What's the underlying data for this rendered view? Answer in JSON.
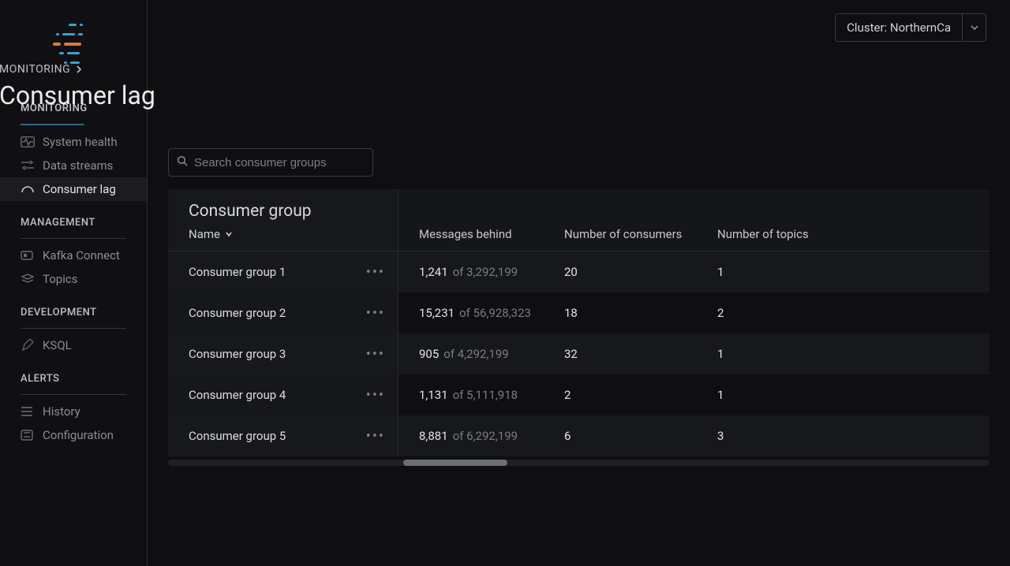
{
  "cluster_selector": {
    "label": "Cluster: NorthernCa"
  },
  "breadcrumb": "MONITORING",
  "page_title": "Consumer lag",
  "search": {
    "placeholder": "Search consumer groups"
  },
  "sidebar": {
    "sections": {
      "monitoring": {
        "title": "MONITORING",
        "items": [
          {
            "label": "System health"
          },
          {
            "label": "Data streams"
          },
          {
            "label": "Consumer lag"
          }
        ]
      },
      "management": {
        "title": "MANAGEMENT",
        "items": [
          {
            "label": "Kafka Connect"
          },
          {
            "label": "Topics"
          }
        ]
      },
      "development": {
        "title": "DEVELOPMENT",
        "items": [
          {
            "label": "KSQL"
          }
        ]
      },
      "alerts": {
        "title": "ALERTS",
        "items": [
          {
            "label": "History"
          },
          {
            "label": "Configuration"
          }
        ]
      }
    }
  },
  "table": {
    "group_header": "Consumer group",
    "sort_label": "Name",
    "headers": {
      "messages": "Messages behind",
      "consumers": "Number of consumers",
      "topics": "Number of topics"
    },
    "rows": [
      {
        "name": "Consumer group 1",
        "behind": "1,241",
        "total": "3,292,199",
        "consumers": "20",
        "topics": "1"
      },
      {
        "name": "Consumer group 2",
        "behind": "15,231",
        "total": "56,928,323",
        "consumers": "18",
        "topics": "2"
      },
      {
        "name": "Consumer group 3",
        "behind": "905",
        "total": "4,292,199",
        "consumers": "32",
        "topics": "1"
      },
      {
        "name": "Consumer group 4",
        "behind": "1,131",
        "total": "5,111,918",
        "consumers": "2",
        "topics": "1"
      },
      {
        "name": "Consumer group 5",
        "behind": "8,881",
        "total": "6,292,199",
        "consumers": "6",
        "topics": "3"
      }
    ]
  }
}
